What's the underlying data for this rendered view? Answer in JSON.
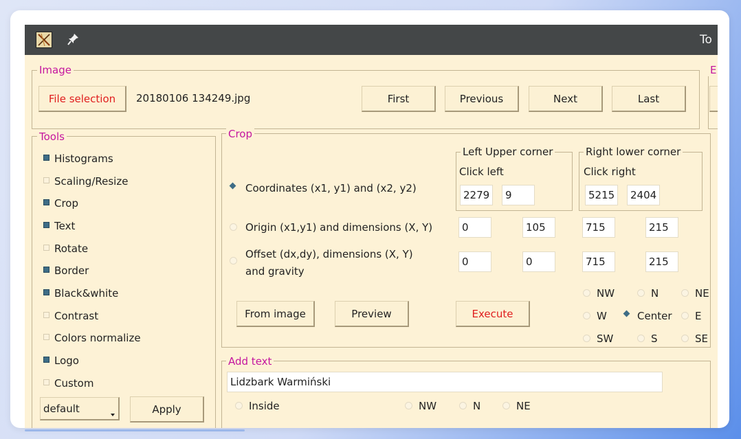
{
  "window": {
    "title": "To"
  },
  "image_panel": {
    "legend": "Image",
    "file_selection_label": "File selection",
    "filename": "20180106 134249.jpg",
    "nav_buttons": [
      "First",
      "Previous",
      "Next",
      "Last"
    ],
    "right_legend_partial": "E"
  },
  "tools": {
    "legend": "Tools",
    "items": [
      {
        "label": "Histograms",
        "checked": true
      },
      {
        "label": "Scaling/Resize",
        "checked": false
      },
      {
        "label": "Crop",
        "checked": true
      },
      {
        "label": "Text",
        "checked": true
      },
      {
        "label": "Rotate",
        "checked": false
      },
      {
        "label": "Border",
        "checked": true
      },
      {
        "label": "Black&white",
        "checked": true
      },
      {
        "label": "Contrast",
        "checked": false
      },
      {
        "label": "Colors normalize",
        "checked": false
      },
      {
        "label": "Logo",
        "checked": true
      },
      {
        "label": "Custom",
        "checked": false
      }
    ],
    "preset_value": "default",
    "apply_label": "Apply"
  },
  "crop": {
    "legend": "Crop",
    "left_upper": {
      "legend": "Left Upper corner",
      "hint": "Click left",
      "x": "2279",
      "y": "9"
    },
    "right_lower": {
      "legend": "Right lower corner",
      "hint": "Click right",
      "x": "5215",
      "y": "2404"
    },
    "modes": [
      {
        "label": "Coordinates (x1, y1) and (x2, y2)",
        "selected": true
      },
      {
        "label": "Origin (x1,y1) and dimensions (X, Y)",
        "selected": false
      },
      {
        "label": "Offset (dx,dy), dimensions (X, Y) and gravity",
        "selected": false
      }
    ],
    "origin_values": [
      "0",
      "105",
      "715",
      "215"
    ],
    "offset_values": [
      "0",
      "0",
      "715",
      "215"
    ],
    "gravity": [
      "NW",
      "N",
      "NE",
      "W",
      "Center",
      "E",
      "SW",
      "S",
      "SE"
    ],
    "gravity_selected": "Center",
    "from_image_label": "From image",
    "preview_label": "Preview",
    "execute_label": "Execute"
  },
  "add_text": {
    "legend": "Add text",
    "text_value": "Lidzbark Warmiński",
    "position_options": [
      "Inside",
      "NW",
      "N",
      "NE"
    ]
  },
  "colors": {
    "legend": "#c4169f",
    "execute": "#e01e1e",
    "checked": "#3e6d86",
    "panel_bg": "#fdf2d6",
    "titlebar": "#444748"
  }
}
